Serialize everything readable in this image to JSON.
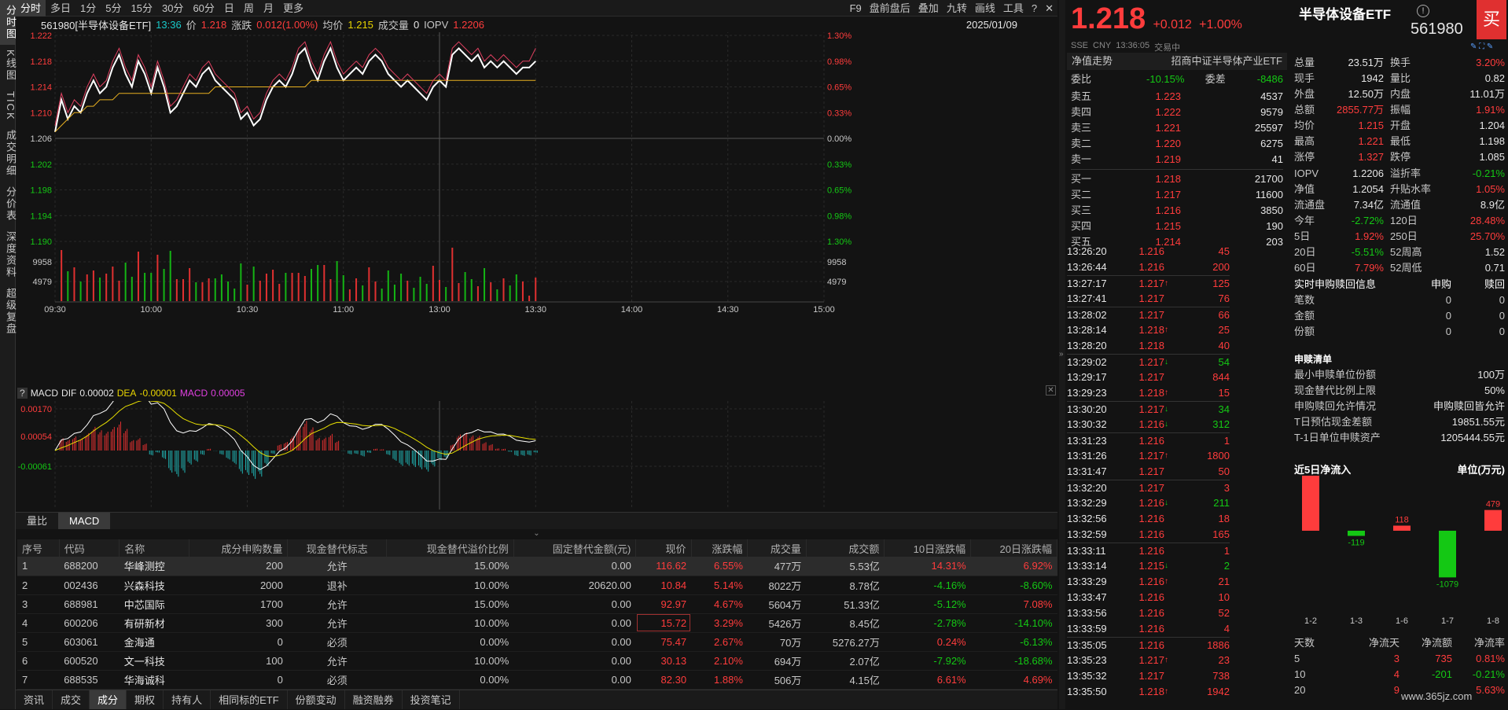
{
  "vtabs": [
    "分时图",
    "K线图",
    "TICK",
    "成交明细",
    "分价表",
    "深度资料",
    "超级复盘"
  ],
  "periods": [
    "分时",
    "多日",
    "1分",
    "5分",
    "15分",
    "30分",
    "60分",
    "日",
    "周",
    "月",
    "更多"
  ],
  "tools": [
    "F9",
    "盘前盘后",
    "叠加",
    "九转",
    "画线",
    "工具"
  ],
  "info": {
    "code": "561980[半导体设备ETF]",
    "time": "13:36",
    "price_label": "价",
    "price": "1.218",
    "chg_label": "涨跌",
    "chg": "0.012(1.00%)",
    "avg_label": "均价",
    "avg": "1.215",
    "vol_label": "成交量",
    "vol": "0",
    "iopv_label": "IOPV",
    "iopv": "1.2206",
    "date": "2025/01/09"
  },
  "chart_data": {
    "type": "line",
    "title": "",
    "y_ticks_left": [
      "1.222",
      "1.218",
      "1.214",
      "1.210",
      "1.206",
      "1.202",
      "1.198",
      "1.194",
      "1.190"
    ],
    "y_ticks_right": [
      "1.30%",
      "0.98%",
      "0.65%",
      "0.33%",
      "0.00%",
      "0.33%",
      "0.65%",
      "0.98%",
      "1.30%"
    ],
    "vol_ticks": [
      "9958",
      "4979"
    ],
    "x_ticks": [
      "09:30",
      "10:00",
      "10:30",
      "11:00",
      "13:00",
      "13:30",
      "14:00",
      "14:30",
      "15:00"
    ],
    "ylim": [
      1.19,
      1.222
    ],
    "series": [
      {
        "name": "price",
        "color": "#ffffff",
        "values": [
          1.207,
          1.212,
          1.209,
          1.211,
          1.21,
          1.213,
          1.215,
          1.213,
          1.214,
          1.217,
          1.219,
          1.216,
          1.214,
          1.218,
          1.216,
          1.213,
          1.217,
          1.214,
          1.21,
          1.211,
          1.213,
          1.215,
          1.214,
          1.216,
          1.217,
          1.215,
          1.214,
          1.213,
          1.212,
          1.209,
          1.21,
          1.208,
          1.209,
          1.212,
          1.214,
          1.215,
          1.214,
          1.216,
          1.219,
          1.22,
          1.217,
          1.215,
          1.218,
          1.22,
          1.217,
          1.215,
          1.216,
          1.217,
          1.216,
          1.218,
          1.219,
          1.218,
          1.216,
          1.215,
          1.214,
          1.215,
          1.214,
          1.213,
          1.212,
          1.214,
          1.215,
          1.214,
          1.219,
          1.22,
          1.219,
          1.218,
          1.219,
          1.217,
          1.218,
          1.217,
          1.218,
          1.217,
          1.216,
          1.217,
          1.217,
          1.218
        ]
      },
      {
        "name": "avg",
        "color": "#e8b020",
        "values": [
          1.207,
          1.208,
          1.209,
          1.21,
          1.21,
          1.211,
          1.211,
          1.212,
          1.212,
          1.212,
          1.213,
          1.213,
          1.213,
          1.213,
          1.213,
          1.213,
          1.213,
          1.213,
          1.213,
          1.213,
          1.213,
          1.213,
          1.213,
          1.213,
          1.213,
          1.214,
          1.214,
          1.214,
          1.214,
          1.214,
          1.214,
          1.214,
          1.214,
          1.214,
          1.214,
          1.214,
          1.214,
          1.214,
          1.214,
          1.214,
          1.215,
          1.215,
          1.215,
          1.215,
          1.215,
          1.215,
          1.215,
          1.215,
          1.215,
          1.215,
          1.215,
          1.215,
          1.215,
          1.215,
          1.215,
          1.215,
          1.215,
          1.215,
          1.215,
          1.215,
          1.215,
          1.215,
          1.215,
          1.215,
          1.215,
          1.215,
          1.215,
          1.215,
          1.215,
          1.215,
          1.215,
          1.215,
          1.215,
          1.215,
          1.215,
          1.215
        ]
      },
      {
        "name": "iopv",
        "color": "#e04060",
        "values": [
          1.208,
          1.213,
          1.21,
          1.212,
          1.211,
          1.214,
          1.216,
          1.214,
          1.215,
          1.218,
          1.22,
          1.217,
          1.215,
          1.219,
          1.217,
          1.214,
          1.218,
          1.215,
          1.211,
          1.212,
          1.214,
          1.216,
          1.215,
          1.217,
          1.218,
          1.216,
          1.215,
          1.214,
          1.213,
          1.21,
          1.211,
          1.209,
          1.21,
          1.213,
          1.215,
          1.216,
          1.215,
          1.217,
          1.22,
          1.221,
          1.218,
          1.216,
          1.219,
          1.221,
          1.218,
          1.216,
          1.217,
          1.218,
          1.217,
          1.219,
          1.22,
          1.219,
          1.217,
          1.216,
          1.215,
          1.216,
          1.215,
          1.214,
          1.213,
          1.215,
          1.216,
          1.215,
          1.22,
          1.221,
          1.22,
          1.219,
          1.22,
          1.218,
          1.219,
          1.218,
          1.219,
          1.218,
          1.217,
          1.218,
          1.218,
          1.22
        ]
      }
    ]
  },
  "macd": {
    "label": "MACD",
    "dif_label": "DIF",
    "dif": "0.00002",
    "dea_label": "DEA",
    "dea": "-0.00001",
    "macd_label": "MACD",
    "macd": "0.00005",
    "ticks": [
      "0.00170",
      "0.00054",
      "-0.00061"
    ]
  },
  "ind_tabs": [
    "量比",
    "MACD"
  ],
  "table": {
    "headers": [
      "序号",
      "代码",
      "名称",
      "成分申购数量",
      "现金替代标志",
      "现金替代溢价比例",
      "固定替代金额(元)",
      "现价",
      "涨跌幅",
      "成交量",
      "成交额",
      "10日涨跌幅",
      "20日涨跌幅"
    ],
    "rows": [
      [
        "1",
        "688200",
        "华峰测控",
        "200",
        "允许",
        "15.00%",
        "0.00",
        "116.62",
        "6.55%",
        "477万",
        "5.53亿",
        "14.31%",
        "6.92%"
      ],
      [
        "2",
        "002436",
        "兴森科技",
        "2000",
        "退补",
        "10.00%",
        "20620.00",
        "10.84",
        "5.14%",
        "8022万",
        "8.78亿",
        "-4.16%",
        "-8.60%"
      ],
      [
        "3",
        "688981",
        "中芯国际",
        "1700",
        "允许",
        "15.00%",
        "0.00",
        "92.97",
        "4.67%",
        "5604万",
        "51.33亿",
        "-5.12%",
        "7.08%"
      ],
      [
        "4",
        "600206",
        "有研新材",
        "300",
        "允许",
        "10.00%",
        "0.00",
        "15.72",
        "3.29%",
        "5426万",
        "8.45亿",
        "-2.78%",
        "-14.10%"
      ],
      [
        "5",
        "603061",
        "金海通",
        "0",
        "必须",
        "0.00%",
        "0.00",
        "75.47",
        "2.67%",
        "70万",
        "5276.27万",
        "0.24%",
        "-6.13%"
      ],
      [
        "6",
        "600520",
        "文一科技",
        "100",
        "允许",
        "10.00%",
        "0.00",
        "30.13",
        "2.10%",
        "694万",
        "2.07亿",
        "-7.92%",
        "-18.68%"
      ],
      [
        "7",
        "688535",
        "华海诚科",
        "0",
        "必须",
        "0.00%",
        "0.00",
        "82.30",
        "1.88%",
        "506万",
        "4.15亿",
        "6.61%",
        "4.69%"
      ]
    ]
  },
  "bottom_tabs": [
    "资讯",
    "成交",
    "成分",
    "期权",
    "持有人",
    "相同标的ETF",
    "份额变动",
    "融资融券",
    "投资笔记"
  ],
  "quote": {
    "price": "1.218",
    "chg": "+0.012",
    "pct": "+1.00%",
    "name": "半导体设备ETF",
    "code": "561980",
    "buy_badge": "买",
    "exch": "SSE",
    "cur": "CNY",
    "qtime": "13:36:05",
    "status": "交易中"
  },
  "nav": {
    "label": "净值走势",
    "index": "招商中证半导体产业ETF"
  },
  "wb": {
    "label1": "委比",
    "v1": "-10.15%",
    "label2": "委差",
    "v2": "-8486"
  },
  "asks": [
    [
      "卖五",
      "1.223",
      "4537"
    ],
    [
      "卖四",
      "1.222",
      "9579"
    ],
    [
      "卖三",
      "1.221",
      "25597"
    ],
    [
      "卖二",
      "1.220",
      "6275"
    ],
    [
      "卖一",
      "1.219",
      "41"
    ]
  ],
  "bids": [
    [
      "买一",
      "1.218",
      "21700"
    ],
    [
      "买二",
      "1.217",
      "11600"
    ],
    [
      "买三",
      "1.216",
      "3850"
    ],
    [
      "买四",
      "1.215",
      "190"
    ],
    [
      "买五",
      "1.214",
      "203"
    ]
  ],
  "ticks": [
    [
      "13:26:20",
      "1.216",
      "",
      "45"
    ],
    [
      "13:26:44",
      "1.216",
      "",
      "200"
    ],
    [
      "13:27:17",
      "1.217",
      "up",
      "125"
    ],
    [
      "13:27:41",
      "1.217",
      "",
      "76"
    ],
    [
      "13:28:02",
      "1.217",
      "",
      "66"
    ],
    [
      "13:28:14",
      "1.218",
      "up",
      "25"
    ],
    [
      "13:28:20",
      "1.218",
      "",
      "40"
    ],
    [
      "13:29:02",
      "1.217",
      "down",
      "54"
    ],
    [
      "13:29:17",
      "1.217",
      "",
      "844"
    ],
    [
      "13:29:23",
      "1.218",
      "up",
      "15"
    ],
    [
      "13:30:20",
      "1.217",
      "down",
      "34"
    ],
    [
      "13:30:32",
      "1.216",
      "down",
      "312"
    ],
    [
      "13:31:23",
      "1.216",
      "",
      "1"
    ],
    [
      "13:31:26",
      "1.217",
      "up",
      "1800"
    ],
    [
      "13:31:47",
      "1.217",
      "",
      "50"
    ],
    [
      "13:32:20",
      "1.217",
      "",
      "3"
    ],
    [
      "13:32:29",
      "1.216",
      "down",
      "211"
    ],
    [
      "13:32:56",
      "1.216",
      "",
      "18"
    ],
    [
      "13:32:59",
      "1.216",
      "",
      "165"
    ],
    [
      "13:33:11",
      "1.216",
      "",
      "1"
    ],
    [
      "13:33:14",
      "1.215",
      "down",
      "2"
    ],
    [
      "13:33:29",
      "1.216",
      "up",
      "21"
    ],
    [
      "13:33:47",
      "1.216",
      "",
      "10"
    ],
    [
      "13:33:56",
      "1.216",
      "",
      "52"
    ],
    [
      "13:33:59",
      "1.216",
      "",
      "4"
    ],
    [
      "13:35:05",
      "1.216",
      "",
      "1886"
    ],
    [
      "13:35:23",
      "1.217",
      "up",
      "23"
    ],
    [
      "13:35:32",
      "1.217",
      "",
      "738"
    ],
    [
      "13:35:50",
      "1.218",
      "up",
      "1942"
    ]
  ],
  "stats": [
    [
      "总量",
      "23.51万",
      "换手",
      "3.20%"
    ],
    [
      "现手",
      "1942",
      "量比",
      "0.82"
    ],
    [
      "外盘",
      "12.50万",
      "内盘",
      "11.01万"
    ],
    [
      "总额",
      "2855.77万",
      "振幅",
      "1.91%"
    ],
    [
      "均价",
      "1.215",
      "开盘",
      "1.204"
    ],
    [
      "最高",
      "1.221",
      "最低",
      "1.198"
    ],
    [
      "涨停",
      "1.327",
      "跌停",
      "1.085"
    ]
  ],
  "stats2": [
    [
      "IOPV",
      "1.2206",
      "溢折率",
      "-0.21%"
    ],
    [
      "净值",
      "1.2054",
      "升贴水率",
      "1.05%"
    ],
    [
      "流通盘",
      "7.34亿",
      "流通值",
      "8.9亿"
    ],
    [
      "今年",
      "-2.72%",
      "120日",
      "28.48%"
    ],
    [
      "5日",
      "1.92%",
      "250日",
      "25.70%"
    ],
    [
      "20日",
      "-5.51%",
      "52周高",
      "1.52"
    ],
    [
      "60日",
      "7.79%",
      "52周低",
      "0.71"
    ]
  ],
  "redeem": {
    "title": "实时申购赎回信息",
    "c1": "申购",
    "c2": "赎回",
    "rows": [
      [
        "笔数",
        "0",
        "0"
      ],
      [
        "金额",
        "0",
        "0"
      ],
      [
        "份额",
        "0",
        "0"
      ]
    ]
  },
  "sg": {
    "title": "申赎清单",
    "rows": [
      [
        "最小申赎单位份额",
        "100万"
      ],
      [
        "现金替代比例上限",
        "50%"
      ],
      [
        "申购赎回允许情况",
        "申购赎回皆允许"
      ],
      [
        "T日预估现金差额",
        "19851.55元"
      ],
      [
        "T-1日单位申赎资产",
        "1205444.55元"
      ]
    ]
  },
  "flow": {
    "title": "近5日净流入",
    "unit": "单位(万元)",
    "labels": [
      "1-2",
      "1-3",
      "1-6",
      "1-7",
      "1-8"
    ],
    "values": [
      1336,
      -119,
      118,
      -1079,
      479
    ]
  },
  "flow_tbl": {
    "headers": [
      "天数",
      "净流天",
      "净流额",
      "净流率"
    ],
    "rows": [
      [
        "5",
        "3",
        "735",
        "0.81%"
      ],
      [
        "10",
        "4",
        "-201",
        "-0.21%"
      ],
      [
        "20",
        "9",
        "",
        "5.63%"
      ]
    ]
  },
  "watermark": "www.365jz.com"
}
